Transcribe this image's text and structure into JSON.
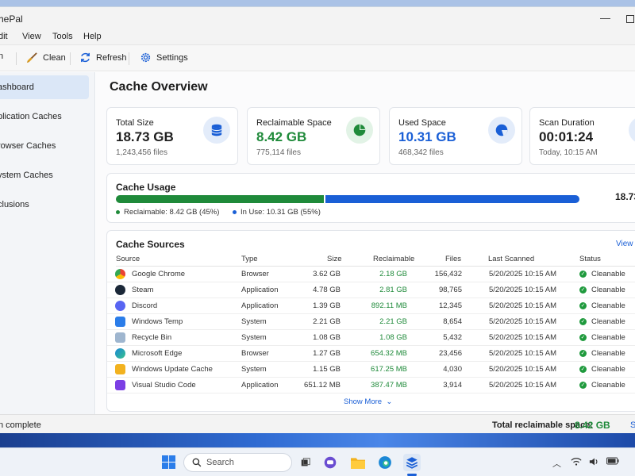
{
  "window": {
    "title": "hePal",
    "minimize_glyph": "—"
  },
  "menu": [
    "dit",
    "View",
    "Tools",
    "Help"
  ],
  "toolbar": {
    "items": [
      {
        "label": "n",
        "icon": "scan-icon"
      },
      {
        "label": "Clean",
        "icon": "broom-icon"
      },
      {
        "label": "Refresh",
        "icon": "refresh-icon"
      },
      {
        "label": "Settings",
        "icon": "gear-icon"
      }
    ]
  },
  "sidebar": {
    "items": [
      {
        "label": "ashboard",
        "active": true
      },
      {
        "label": "plication Caches",
        "active": false
      },
      {
        "label": "rowser Caches",
        "active": false
      },
      {
        "label": "ystem Caches",
        "active": false
      },
      {
        "label": "clusions",
        "active": false
      }
    ]
  },
  "main": {
    "title": "Cache Overview",
    "cards": [
      {
        "label": "Total Size",
        "value": "18.73 GB",
        "sub": "1,243,456 files",
        "value_color": "#1f1f1f",
        "icon": "database-icon"
      },
      {
        "label": "Reclaimable Space",
        "value": "8.42 GB",
        "sub": "775,114 files",
        "value_color": "#1f8a3a",
        "icon": "pie-chart-green-icon"
      },
      {
        "label": "Used Space",
        "value": "10.31 GB",
        "sub": "468,342 files",
        "value_color": "#1a5fd6",
        "icon": "pie-chart-blue-icon"
      },
      {
        "label": "Scan Duration",
        "value": "00:01:24",
        "sub": "Today, 10:15 AM",
        "value_color": "#1f1f1f",
        "icon": "clock-icon"
      }
    ],
    "usage": {
      "title": "Cache Usage",
      "reclaimable_fraction": 0.45,
      "in_use_fraction": 0.55,
      "total": "18.73",
      "legend_reclaimable": "Reclaimable: 8.42 GB (45%)",
      "legend_in_use": "In Use: 10.31 GB (55%)"
    },
    "sources": {
      "title": "Cache Sources",
      "view_all": "View D",
      "columns": [
        "Source",
        "Type",
        "Size",
        "Reclaimable",
        "Files",
        "Last Scanned",
        "Status"
      ],
      "rows": [
        {
          "source": "Google Chrome",
          "type": "Browser",
          "size": "3.62 GB",
          "reclaimable": "2.18 GB",
          "files": "156,432",
          "last_scanned": "5/20/2025 10:15 AM",
          "status": "Cleanable",
          "icon": "chrome-icon"
        },
        {
          "source": "Steam",
          "type": "Application",
          "size": "4.78 GB",
          "reclaimable": "2.81 GB",
          "files": "98,765",
          "last_scanned": "5/20/2025 10:15 AM",
          "status": "Cleanable",
          "icon": "steam-icon"
        },
        {
          "source": "Discord",
          "type": "Application",
          "size": "1.39 GB",
          "reclaimable": "892.11 MB",
          "files": "12,345",
          "last_scanned": "5/20/2025 10:15 AM",
          "status": "Cleanable",
          "icon": "discord-icon"
        },
        {
          "source": "Windows Temp",
          "type": "System",
          "size": "2.21 GB",
          "reclaimable": "2.21 GB",
          "files": "8,654",
          "last_scanned": "5/20/2025 10:15 AM",
          "status": "Cleanable",
          "icon": "windows-icon"
        },
        {
          "source": "Recycle Bin",
          "type": "System",
          "size": "1.08 GB",
          "reclaimable": "1.08 GB",
          "files": "5,432",
          "last_scanned": "5/20/2025 10:15 AM",
          "status": "Cleanable",
          "icon": "recycle-bin-icon"
        },
        {
          "source": "Microsoft Edge",
          "type": "Browser",
          "size": "1.27 GB",
          "reclaimable": "654.32 MB",
          "files": "23,456",
          "last_scanned": "5/20/2025 10:15 AM",
          "status": "Cleanable",
          "icon": "edge-icon"
        },
        {
          "source": "Windows Update Cache",
          "type": "System",
          "size": "1.15 GB",
          "reclaimable": "617.25 MB",
          "files": "4,030",
          "last_scanned": "5/20/2025 10:15 AM",
          "status": "Cleanable",
          "icon": "folder-icon"
        },
        {
          "source": "Visual Studio Code",
          "type": "Application",
          "size": "651.12 MB",
          "reclaimable": "387.47 MB",
          "files": "3,914",
          "last_scanned": "5/20/2025 10:15 AM",
          "status": "Cleanable",
          "icon": "vscode-icon"
        }
      ],
      "show_more": "Show More"
    }
  },
  "statusbar": {
    "left": "n complete",
    "right_label": "Total reclaimable space:",
    "right_value": "8.42 GB",
    "extra": "S"
  },
  "taskbar": {
    "search_placeholder": "Search"
  }
}
